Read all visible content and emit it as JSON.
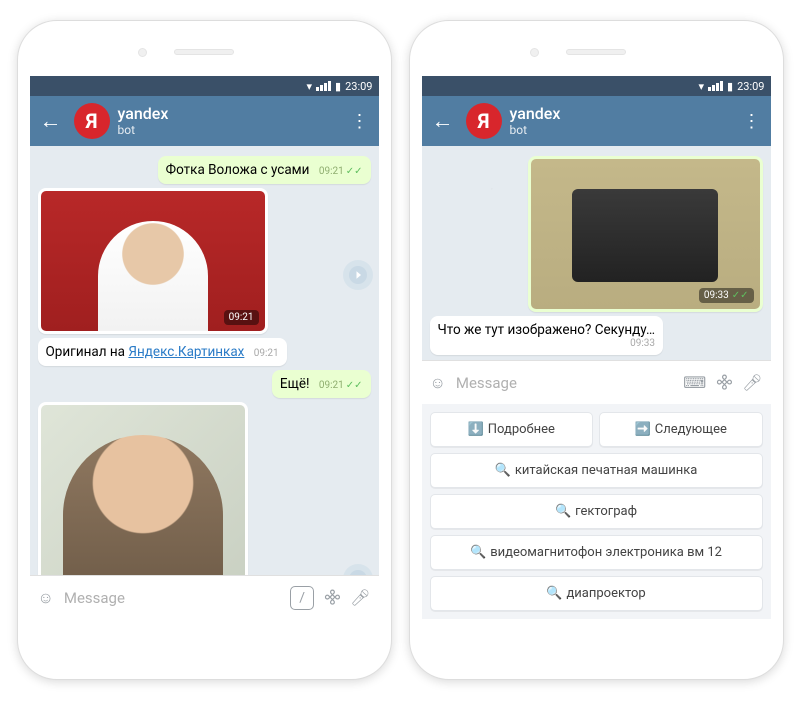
{
  "status": {
    "time": "23:09"
  },
  "header": {
    "name": "yandex",
    "subtitle": "bot",
    "avatar_letter": "Я"
  },
  "left": {
    "msg1": {
      "text": "Фотка Воложа с усами",
      "time": "09:21"
    },
    "img1": {
      "time": "09:21"
    },
    "msg2": {
      "prefix": "Оригинал на ",
      "link": "Яндекс.Картинках",
      "time": "09:21"
    },
    "msg3": {
      "text": "Ещё!",
      "time": "09:21"
    },
    "input_placeholder": "Message"
  },
  "right": {
    "img1": {
      "time": "09:33"
    },
    "msg1": {
      "text": "Что же тут изображено? Секунду…",
      "time": "09:33"
    },
    "input_placeholder": "Message",
    "keyboard": {
      "row1": [
        {
          "icon": "⬇️",
          "label": "Подробнее"
        },
        {
          "icon": "➡️",
          "label": "Следующее"
        }
      ],
      "row2": {
        "icon": "🔍",
        "label": "китайская печатная машинка"
      },
      "row3": {
        "icon": "🔍",
        "label": "гектограф"
      },
      "row4": {
        "icon": "🔍",
        "label": "видеомагнитофон электроника вм 12"
      },
      "row5": {
        "icon": "🔍",
        "label": "диапроектор"
      }
    }
  }
}
